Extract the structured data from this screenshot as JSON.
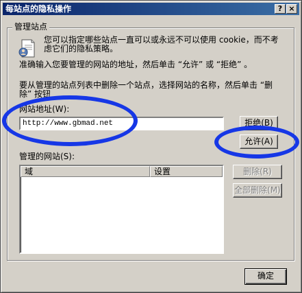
{
  "window": {
    "title": "每站点的隐私操作",
    "help_button": "?",
    "close_button": "×"
  },
  "group": {
    "label": "管理站点",
    "description_line1": "您可以指定哪些站点一直可以或永远不可以使用 cookie，而不考",
    "description_line2": "虑它们的隐私策略。",
    "instruction_add": "准确输入您要管理的网站的地址，然后单击 “允许” 或 “拒绝” 。",
    "instruction_remove_line1": "要从管理的站点列表中删除一个站点，选择网站的名称，然后单击 “删",
    "instruction_remove_line2": "除” 按钮"
  },
  "address": {
    "label": "网站地址(W):",
    "value": "http://www.gbmad.net"
  },
  "buttons": {
    "block": "拒绝(B)",
    "allow": "允许(A)",
    "remove": "删除(R)",
    "remove_all": "全部删除(M)",
    "ok": "确定"
  },
  "managed": {
    "label": "管理的网站(S):",
    "columns": [
      "域",
      "设置"
    ]
  },
  "colors": {
    "annotation": "#1637e6"
  }
}
